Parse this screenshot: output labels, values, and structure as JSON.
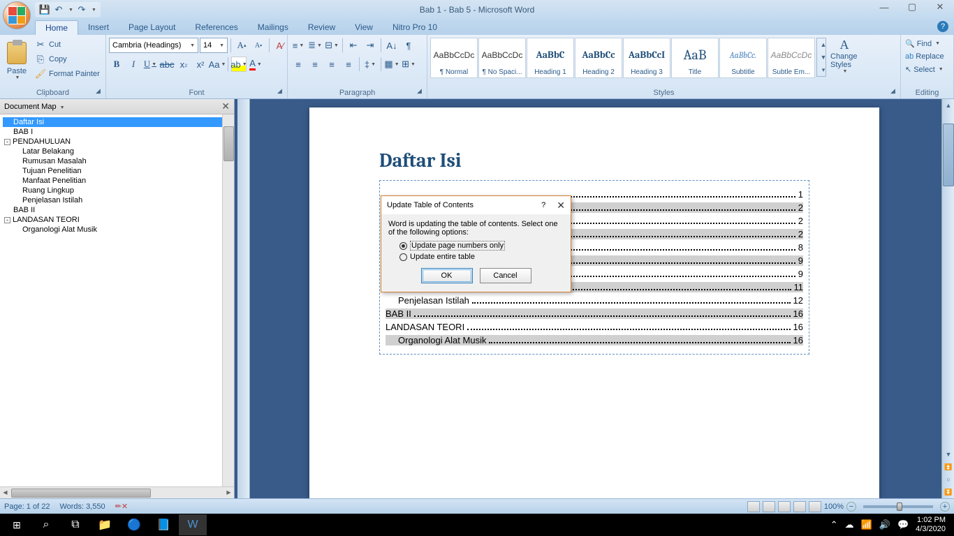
{
  "window": {
    "title": "Bab 1 - Bab 5 - Microsoft Word"
  },
  "qat": {
    "save": "💾",
    "undo": "↶",
    "redo": "↷"
  },
  "tabs": [
    "Home",
    "Insert",
    "Page Layout",
    "References",
    "Mailings",
    "Review",
    "View",
    "Nitro Pro 10"
  ],
  "active_tab_index": 0,
  "ribbon": {
    "clipboard": {
      "label": "Clipboard",
      "paste": "Paste",
      "cut": "Cut",
      "copy": "Copy",
      "painter": "Format Painter"
    },
    "font": {
      "label": "Font",
      "name": "Cambria (Headings)",
      "size": "14"
    },
    "paragraph": {
      "label": "Paragraph"
    },
    "styles": {
      "label": "Styles",
      "items": [
        {
          "preview": "AaBbCcDc",
          "name": "¶ Normal",
          "cls": ""
        },
        {
          "preview": "AaBbCcDc",
          "name": "¶ No Spaci...",
          "cls": ""
        },
        {
          "preview": "AaBbC",
          "name": "Heading 1",
          "cls": "heading"
        },
        {
          "preview": "AaBbCc",
          "name": "Heading 2",
          "cls": "heading"
        },
        {
          "preview": "AaBbCcI",
          "name": "Heading 3",
          "cls": "heading"
        },
        {
          "preview": "AaB",
          "name": "Title",
          "cls": "title-st"
        },
        {
          "preview": "AaBbCc.",
          "name": "Subtitle",
          "cls": "subtitle"
        },
        {
          "preview": "AaBbCcDc",
          "name": "Subtle Em...",
          "cls": "emph"
        }
      ],
      "change": "Change Styles"
    },
    "editing": {
      "label": "Editing",
      "find": "Find",
      "replace": "Replace",
      "select": "Select"
    }
  },
  "docmap": {
    "title": "Document Map",
    "items": [
      {
        "text": "Daftar Isi",
        "level": 0,
        "selected": true,
        "expand": null
      },
      {
        "text": "BAB I",
        "level": 0,
        "expand": null
      },
      {
        "text": "PENDAHULUAN",
        "level": 0,
        "expand": "-"
      },
      {
        "text": "Latar Belakang",
        "level": 2
      },
      {
        "text": "Rumusan Masalah",
        "level": 2
      },
      {
        "text": "Tujuan Penelitian",
        "level": 2
      },
      {
        "text": "Manfaat Penelitian",
        "level": 2
      },
      {
        "text": "Ruang Lingkup",
        "level": 2
      },
      {
        "text": "Penjelasan Istilah",
        "level": 2
      },
      {
        "text": "BAB II",
        "level": 0,
        "expand": null
      },
      {
        "text": "LANDASAN TEORI",
        "level": 0,
        "expand": "-"
      },
      {
        "text": "Organologi Alat Musik",
        "level": 2
      }
    ]
  },
  "document": {
    "title": "Daftar Isi",
    "toc": [
      {
        "text": "",
        "page": "1",
        "level": 1,
        "gray": false
      },
      {
        "text": "",
        "page": "2",
        "level": 1,
        "gray": true
      },
      {
        "text": "PENDAHULUAN",
        "page": "2",
        "level": 1,
        "gray": false
      },
      {
        "text": "Latar Belakang",
        "page": "2",
        "level": 2,
        "gray": true
      },
      {
        "text": "Rumusan Masalah",
        "page": "8",
        "level": 2,
        "gray": false
      },
      {
        "text": "Tujuan Penelitian",
        "page": "9",
        "level": 2,
        "gray": true
      },
      {
        "text": "Manfaat Penelitian",
        "page": "9",
        "level": 2,
        "gray": false
      },
      {
        "text": "Ruang Lingkup",
        "page": "11",
        "level": 2,
        "gray": true
      },
      {
        "text": "Penjelasan Istilah",
        "page": "12",
        "level": 2,
        "gray": false
      },
      {
        "text": "BAB II",
        "page": "16",
        "level": 1,
        "gray": true
      },
      {
        "text": "LANDASAN TEORI",
        "page": "16",
        "level": 1,
        "gray": false
      },
      {
        "text": "Organologi Alat Musik",
        "page": "16",
        "level": 2,
        "gray": true
      }
    ]
  },
  "dialog": {
    "title": "Update Table of Contents",
    "message": "Word is updating the table of contents.  Select one of the following options:",
    "opt1": "Update page numbers only",
    "opt2": "Update entire table",
    "ok": "OK",
    "cancel": "Cancel"
  },
  "statusbar": {
    "page": "Page: 1 of 22",
    "words": "Words: 3,550",
    "zoom": "100%"
  },
  "taskbar": {
    "time": "1:02 PM",
    "date": "4/3/2020"
  }
}
